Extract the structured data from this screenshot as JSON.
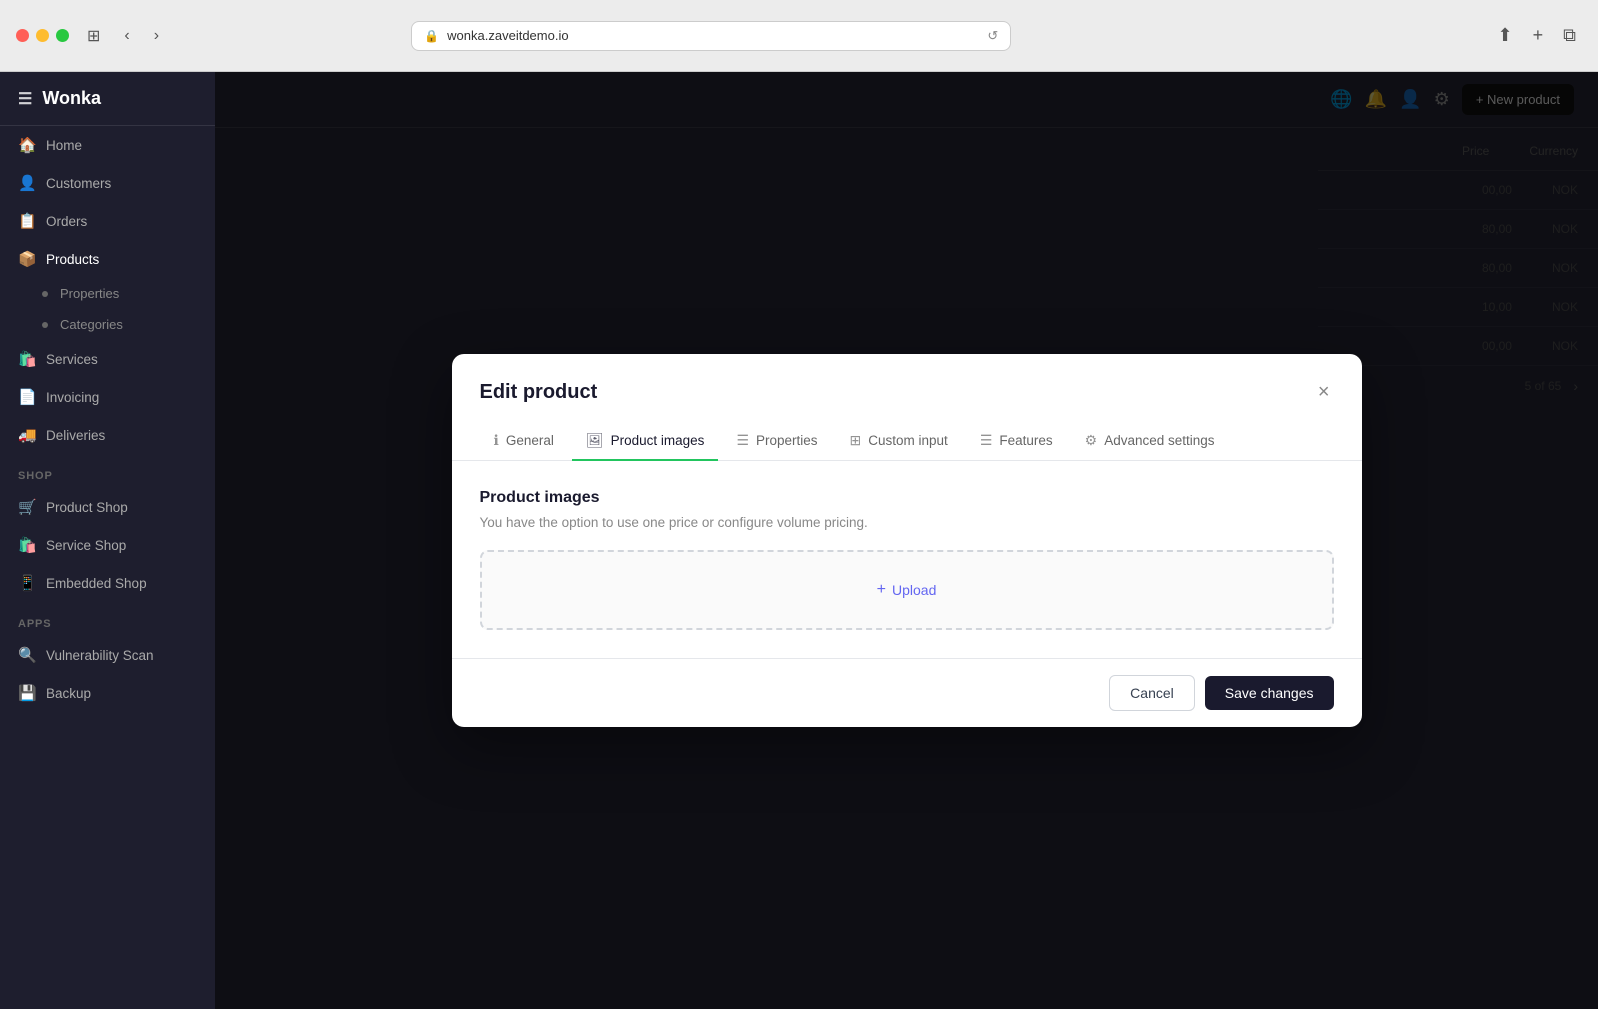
{
  "browser": {
    "url": "wonka.zaveitdemo.io",
    "reload_label": "↺"
  },
  "sidebar": {
    "app_name": "Wonka",
    "items": [
      {
        "id": "home",
        "icon": "🏠",
        "label": "Home"
      },
      {
        "id": "customers",
        "icon": "👤",
        "label": "Customers"
      },
      {
        "id": "orders",
        "icon": "📋",
        "label": "Orders"
      },
      {
        "id": "products",
        "icon": "📦",
        "label": "Products"
      },
      {
        "id": "properties",
        "icon": "•",
        "label": "Properties",
        "sub": true
      },
      {
        "id": "categories",
        "icon": "•",
        "label": "Categories",
        "sub": true
      },
      {
        "id": "services",
        "icon": "🛍️",
        "label": "Services"
      },
      {
        "id": "invoicing",
        "icon": "📄",
        "label": "Invoicing"
      },
      {
        "id": "deliveries",
        "icon": "🚚",
        "label": "Deliveries"
      }
    ],
    "shop_section": "SHOP",
    "shop_items": [
      {
        "id": "product-shop",
        "icon": "🛒",
        "label": "Product Shop"
      },
      {
        "id": "service-shop",
        "icon": "🛍️",
        "label": "Service Shop"
      },
      {
        "id": "embedded-shop",
        "icon": "📱",
        "label": "Embedded Shop"
      }
    ],
    "apps_section": "APPS",
    "apps_items": [
      {
        "id": "vulnerability-scan",
        "icon": "🔍",
        "label": "Vulnerability Scan"
      },
      {
        "id": "backup",
        "icon": "💾",
        "label": "Backup"
      }
    ]
  },
  "topbar": {
    "new_product_label": "+ New product"
  },
  "bg_table": {
    "headers": [
      "Price",
      "Currency"
    ],
    "rows": [
      {
        "price": "00,00",
        "currency": "NOK"
      },
      {
        "price": "80,00",
        "currency": "NOK"
      },
      {
        "price": "80,00",
        "currency": "NOK"
      },
      {
        "price": "10,00",
        "currency": "NOK"
      },
      {
        "price": "00,00",
        "currency": "NOK"
      }
    ],
    "pagination": "5 of 65"
  },
  "modal": {
    "title": "Edit product",
    "close_icon": "×",
    "tabs": [
      {
        "id": "general",
        "icon": "ℹ",
        "label": "General"
      },
      {
        "id": "product-images",
        "icon": "🖼",
        "label": "Product images",
        "active": true
      },
      {
        "id": "properties",
        "icon": "☰",
        "label": "Properties"
      },
      {
        "id": "custom-input",
        "icon": "⊞",
        "label": "Custom input"
      },
      {
        "id": "features",
        "icon": "☰",
        "label": "Features"
      },
      {
        "id": "advanced-settings",
        "icon": "⚙",
        "label": "Advanced settings"
      }
    ],
    "section_title": "Product images",
    "section_desc": "You have the option to use one price or configure volume pricing.",
    "upload_label": "+ Upload",
    "footer": {
      "cancel_label": "Cancel",
      "save_label": "Save changes"
    }
  }
}
